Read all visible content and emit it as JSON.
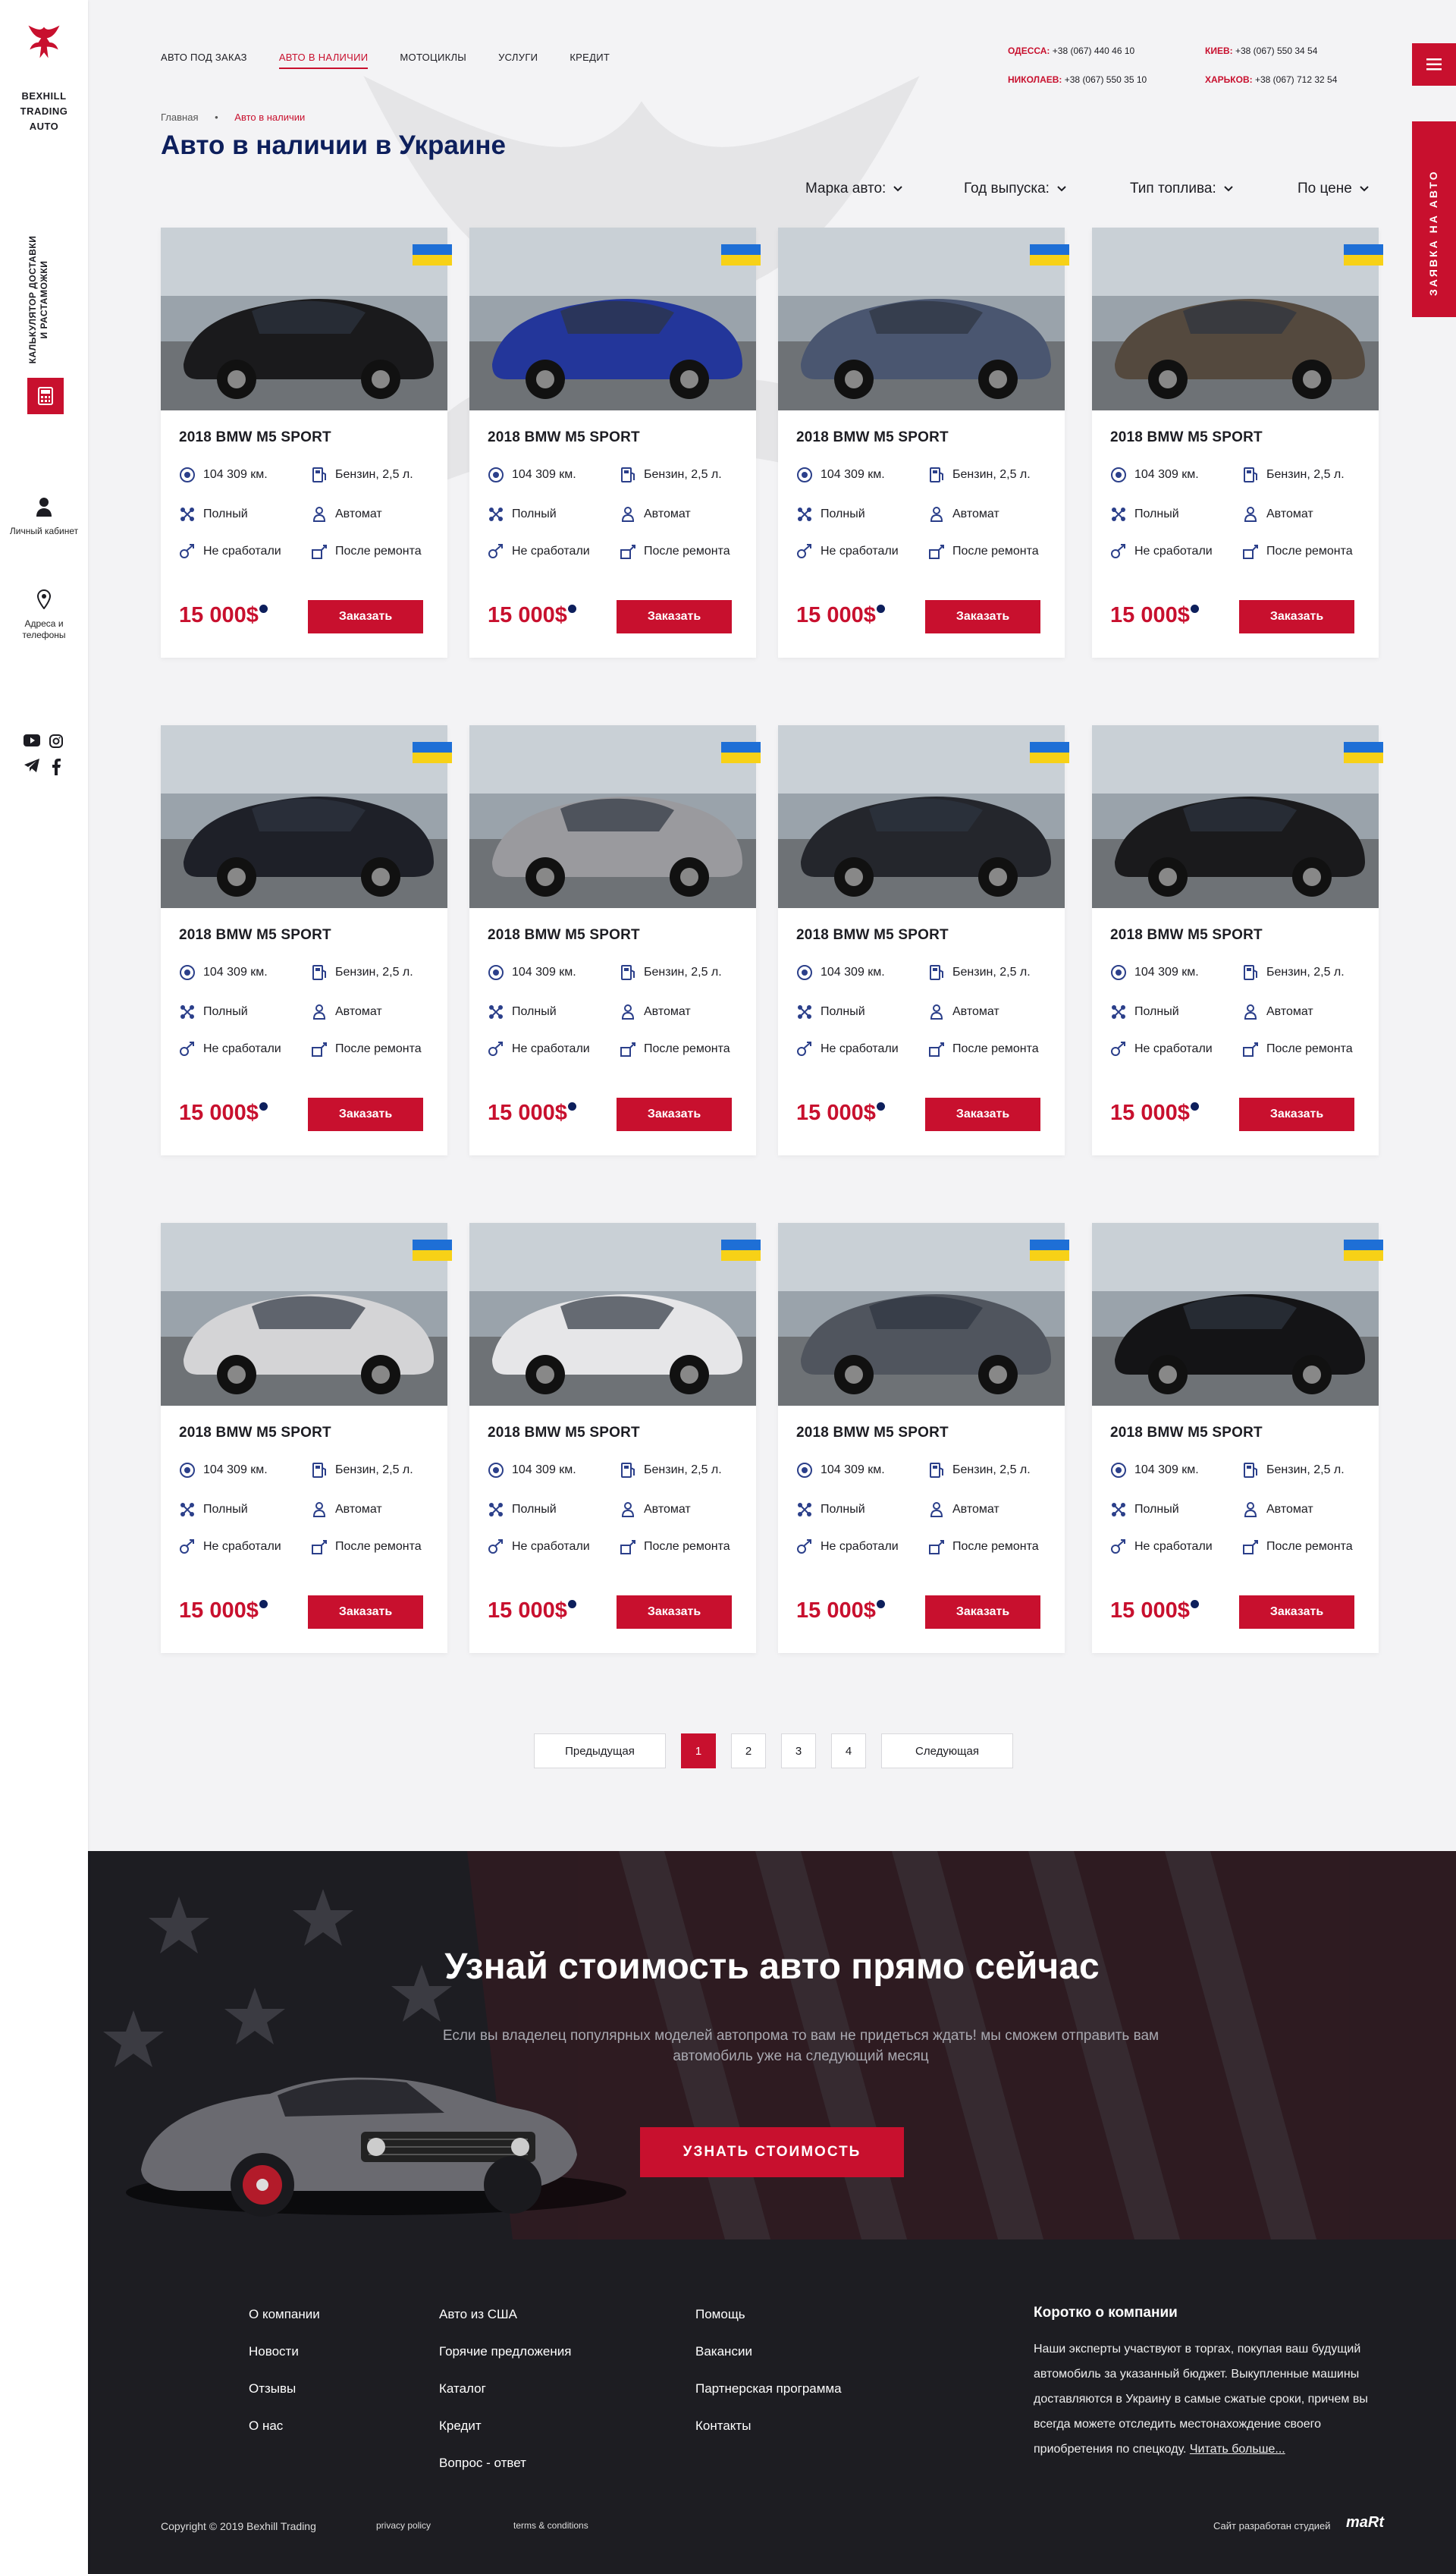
{
  "brand": {
    "name_line1": "BEXHILL",
    "name_line2": "TRADING",
    "name_line3": "AUTO"
  },
  "sidebar": {
    "calculator_label": "Калькулятор доставки и растаможки",
    "cabinet_label": "Личный кабинет",
    "addresses_label": "Адреса и телефоны",
    "socials": [
      "youtube-icon",
      "instagram-icon",
      "telegram-icon",
      "facebook-icon"
    ]
  },
  "nav": {
    "items": [
      "АВТО ПОД ЗАКАЗ",
      "АВТО В НАЛИЧИИ",
      "МОТОЦИКЛЫ",
      "УСЛУГИ",
      "КРЕДИТ"
    ],
    "active_index": 1
  },
  "contacts": [
    {
      "city": "ОДЕССА:",
      "phone": "+38 (067) 440 46 10"
    },
    {
      "city": "КИЕВ:",
      "phone": "+38 (067) 550 34 54"
    },
    {
      "city": "НИКОЛАЕВ:",
      "phone": "+38 (067) 550 35 10"
    },
    {
      "city": "ХАРЬКОВ:",
      "phone": "+38 (067) 712 32 54"
    }
  ],
  "request_tab": "ЗАЯВКА НА АВТО",
  "breadcrumb": {
    "home": "Главная",
    "separator": "•",
    "current": "Авто в наличии"
  },
  "page_title": "Авто в наличии в Украине",
  "filters": [
    "Марка авто:",
    "Год выпуска:",
    "Тип топлива:",
    "По цене"
  ],
  "cards": [
    {
      "title": "2018 BMW M5 SPORT",
      "mileage": "104 309 км.",
      "fuel": "Бензин, 2,5 л.",
      "drive": "Полный",
      "gearbox": "Автомат",
      "airbags": "Не сработали",
      "condition": "После ремонта",
      "price": "15 000$",
      "order": "Заказать",
      "color": "#1a1a1c"
    },
    {
      "title": "2018 BMW M5 SPORT",
      "mileage": "104 309 км.",
      "fuel": "Бензин, 2,5 л.",
      "drive": "Полный",
      "gearbox": "Автомат",
      "airbags": "Не сработали",
      "condition": "После ремонта",
      "price": "15 000$",
      "order": "Заказать",
      "color": "#23369a"
    },
    {
      "title": "2018 BMW M5 SPORT",
      "mileage": "104 309 км.",
      "fuel": "Бензин, 2,5 л.",
      "drive": "Полный",
      "gearbox": "Автомат",
      "airbags": "Не сработали",
      "condition": "После ремонта",
      "price": "15 000$",
      "order": "Заказать",
      "color": "#4a5670"
    },
    {
      "title": "2018 BMW M5 SPORT",
      "mileage": "104 309 км.",
      "fuel": "Бензин, 2,5 л.",
      "drive": "Полный",
      "gearbox": "Автомат",
      "airbags": "Не сработали",
      "condition": "После ремонта",
      "price": "15 000$",
      "order": "Заказать",
      "color": "#54493e"
    },
    {
      "title": "2018 BMW M5 SPORT",
      "mileage": "104 309 км.",
      "fuel": "Бензин, 2,5 л.",
      "drive": "Полный",
      "gearbox": "Автомат",
      "airbags": "Не сработали",
      "condition": "После ремонта",
      "price": "15 000$",
      "order": "Заказать",
      "color": "#1e2028"
    },
    {
      "title": "2018 BMW M5 SPORT",
      "mileage": "104 309 км.",
      "fuel": "Бензин, 2,5 л.",
      "drive": "Полный",
      "gearbox": "Автомат",
      "airbags": "Не сработали",
      "condition": "После ремонта",
      "price": "15 000$",
      "order": "Заказать",
      "color": "#9a9a9e"
    },
    {
      "title": "2018 BMW M5 SPORT",
      "mileage": "104 309 км.",
      "fuel": "Бензин, 2,5 л.",
      "drive": "Полный",
      "gearbox": "Автомат",
      "airbags": "Не сработали",
      "condition": "После ремонта",
      "price": "15 000$",
      "order": "Заказать",
      "color": "#24262c"
    },
    {
      "title": "2018 BMW M5 SPORT",
      "mileage": "104 309 км.",
      "fuel": "Бензин, 2,5 л.",
      "drive": "Полный",
      "gearbox": "Автомат",
      "airbags": "Не сработали",
      "condition": "После ремонта",
      "price": "15 000$",
      "order": "Заказать",
      "color": "#1a1a1c"
    },
    {
      "title": "2018 BMW M5 SPORT",
      "mileage": "104 309 км.",
      "fuel": "Бензин, 2,5 л.",
      "drive": "Полный",
      "gearbox": "Автомат",
      "airbags": "Не сработали",
      "condition": "После ремонта",
      "price": "15 000$",
      "order": "Заказать",
      "color": "#d4d4d6"
    },
    {
      "title": "2018 BMW M5 SPORT",
      "mileage": "104 309 км.",
      "fuel": "Бензин, 2,5 л.",
      "drive": "Полный",
      "gearbox": "Автомат",
      "airbags": "Не сработали",
      "condition": "После ремонта",
      "price": "15 000$",
      "order": "Заказать",
      "color": "#e6e6e8"
    },
    {
      "title": "2018 BMW M5 SPORT",
      "mileage": "104 309 км.",
      "fuel": "Бензин, 2,5 л.",
      "drive": "Полный",
      "gearbox": "Автомат",
      "airbags": "Не сработали",
      "condition": "После ремонта",
      "price": "15 000$",
      "order": "Заказать",
      "color": "#50555e"
    },
    {
      "title": "2018 BMW M5 SPORT",
      "mileage": "104 309 км.",
      "fuel": "Бензин, 2,5 л.",
      "drive": "Полный",
      "gearbox": "Автомат",
      "airbags": "Не сработали",
      "condition": "После ремонта",
      "price": "15 000$",
      "order": "Заказать",
      "color": "#141416"
    }
  ],
  "pagination": {
    "prev": "Предыдущая",
    "pages": [
      "1",
      "2",
      "3",
      "4"
    ],
    "active": "1",
    "next": "Следующая"
  },
  "cta": {
    "title": "Узнай стоимость авто прямо сейчас",
    "text": "Если вы владелец популярных моделей автопрома то вам не придеться ждать! мы сможем отправить вам автомобиль уже на следующий месяц",
    "button": "узнать стоимость"
  },
  "footer": {
    "col1": [
      "О компании",
      "Новости",
      "Отзывы",
      "О нас"
    ],
    "col2": [
      "Авто из США",
      "Горячие предложения",
      "Каталог",
      "Кредит",
      "Вопрос - ответ"
    ],
    "col3": [
      "Помощь",
      "Вакансии",
      "Партнерская программа",
      "Контакты"
    ],
    "about_title": "Коротко о компании",
    "about_text": "Наши эксперты участвуют в торгах, покупая ваш будущий автомобиль за указанный бюджет. Выкупленные машины доставляются в Украину в самые сжатые сроки, причем вы всегда можете отследить местонахождение своего приобретения по спецкоду.",
    "about_more": "Читать больше...",
    "copyright": "Copyright © 2019 Bexhill Trading",
    "privacy": "privacy policy",
    "terms": "terms & conditions",
    "studio": "Сайт разработан студией",
    "studio_logo": "maRt"
  }
}
